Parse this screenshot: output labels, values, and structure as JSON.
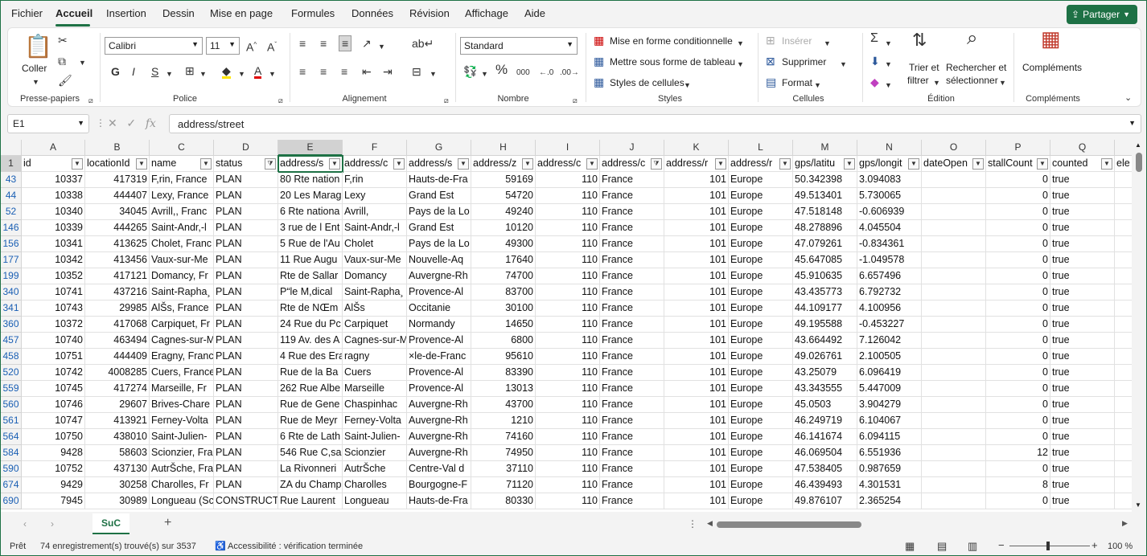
{
  "menu": {
    "tabs": [
      "Fichier",
      "Accueil",
      "Insertion",
      "Dessin",
      "Mise en page",
      "Formules",
      "Données",
      "Révision",
      "Affichage",
      "Aide"
    ],
    "share": "Partager"
  },
  "ribbon": {
    "clipboard": {
      "paste": "Coller",
      "label": "Presse-papiers"
    },
    "font": {
      "name": "Calibri",
      "size": "11",
      "label": "Police"
    },
    "alignment": {
      "label": "Alignement"
    },
    "number": {
      "format": "Standard",
      "label": "Nombre"
    },
    "styles": {
      "conditional": "Mise en forme conditionnelle",
      "table": "Mettre sous forme de tableau",
      "cell_styles": "Styles de cellules",
      "label": "Styles"
    },
    "cells": {
      "insert": "Insérer",
      "delete": "Supprimer",
      "format": "Format",
      "label": "Cellules"
    },
    "editing": {
      "sort1": "Trier et",
      "sort2": "filtrer",
      "find1": "Rechercher et",
      "find2": "sélectionner",
      "label": "Édition"
    },
    "addins": {
      "btn": "Compléments",
      "label": "Compléments"
    }
  },
  "formula_bar": {
    "name_box": "E1",
    "formula": "address/street"
  },
  "columns": [
    "A",
    "B",
    "C",
    "D",
    "E",
    "F",
    "G",
    "H",
    "I",
    "J",
    "K",
    "L",
    "M",
    "N",
    "O",
    "P",
    "Q"
  ],
  "headers": [
    "id",
    "locationId",
    "name",
    "status",
    "address/s",
    "address/c",
    "address/s",
    "address/z",
    "address/c",
    "address/c",
    "address/r",
    "address/r",
    "gps/latitu",
    "gps/longit",
    "dateOpen",
    "stallCount",
    "counted",
    "ele"
  ],
  "rows": [
    [
      "43",
      "10337",
      "417319",
      "F,rin, France",
      "PLAN",
      "80 Rte nation",
      "F,rin",
      "Hauts-de-Fra",
      "59169",
      "110",
      "France",
      "101",
      "Europe",
      "50.342398",
      "3.094083",
      "",
      "0",
      "true"
    ],
    [
      "44",
      "10338",
      "444407",
      "Lexy, France",
      "PLAN",
      "20 Les Marag",
      "Lexy",
      "Grand Est",
      "54720",
      "110",
      "France",
      "101",
      "Europe",
      "49.513401",
      "5.730065",
      "",
      "0",
      "true"
    ],
    [
      "52",
      "10340",
      "34045",
      "Avrill,, Franc",
      "PLAN",
      "6 Rte nationa",
      "Avrill,",
      "Pays de la Lo",
      "49240",
      "110",
      "France",
      "101",
      "Europe",
      "47.518148",
      "-0.606939",
      "",
      "0",
      "true"
    ],
    [
      "146",
      "10339",
      "444265",
      "Saint-Andr,-l",
      "PLAN",
      "3 rue de l Ent",
      "Saint-Andr,-l",
      "Grand Est",
      "10120",
      "110",
      "France",
      "101",
      "Europe",
      "48.278896",
      "4.045504",
      "",
      "0",
      "true"
    ],
    [
      "156",
      "10341",
      "413625",
      "Cholet, Franc",
      "PLAN",
      "5 Rue de l'Au",
      "Cholet",
      "Pays de la Lo",
      "49300",
      "110",
      "France",
      "101",
      "Europe",
      "47.079261",
      "-0.834361",
      "",
      "0",
      "true"
    ],
    [
      "177",
      "10342",
      "413456",
      "Vaux-sur-Me",
      "PLAN",
      "11 Rue Augu",
      "Vaux-sur-Me",
      "Nouvelle-Aq",
      "17640",
      "110",
      "France",
      "101",
      "Europe",
      "45.647085",
      "-1.049578",
      "",
      "0",
      "true"
    ],
    [
      "199",
      "10352",
      "417121",
      "Domancy, Fr",
      "PLAN",
      "Rte de Sallar",
      "Domancy",
      "Auvergne-Rh",
      "74700",
      "110",
      "France",
      "101",
      "Europe",
      "45.910635",
      "6.657496",
      "",
      "0",
      "true"
    ],
    [
      "340",
      "10741",
      "437216",
      "Saint-Rapha¸",
      "PLAN",
      "P“le M,dical",
      "Saint-Rapha¸",
      "Provence-Al",
      "83700",
      "110",
      "France",
      "101",
      "Europe",
      "43.435773",
      "6.792732",
      "",
      "0",
      "true"
    ],
    [
      "341",
      "10743",
      "29985",
      "AlŠs, France",
      "PLAN",
      "Rte de NŒm",
      "AlŠs",
      "Occitanie",
      "30100",
      "110",
      "France",
      "101",
      "Europe",
      "44.109177",
      "4.100956",
      "",
      "0",
      "true"
    ],
    [
      "360",
      "10372",
      "417068",
      "Carpiquet, Fr",
      "PLAN",
      "24 Rue du Pc",
      "Carpiquet",
      "Normandy",
      "14650",
      "110",
      "France",
      "101",
      "Europe",
      "49.195588",
      "-0.453227",
      "",
      "0",
      "true"
    ],
    [
      "457",
      "10740",
      "463494",
      "Cagnes-sur-M",
      "PLAN",
      "119 Av. des A",
      "Cagnes-sur-M",
      "Provence-Al",
      "6800",
      "110",
      "France",
      "101",
      "Europe",
      "43.664492",
      "7.126042",
      "",
      "0",
      "true"
    ],
    [
      "458",
      "10751",
      "444409",
      "Eragny, Franc",
      "PLAN",
      "4 Rue des Era",
      "ragny",
      "×le-de-Franc",
      "95610",
      "110",
      "France",
      "101",
      "Europe",
      "49.026761",
      "2.100505",
      "",
      "0",
      "true"
    ],
    [
      "520",
      "10742",
      "4008285",
      "Cuers, France",
      "PLAN",
      "Rue de la Ba",
      "Cuers",
      "Provence-Al",
      "83390",
      "110",
      "France",
      "101",
      "Europe",
      "43.25079",
      "6.096419",
      "",
      "0",
      "true"
    ],
    [
      "559",
      "10745",
      "417274",
      "Marseille, Fr",
      "PLAN",
      "262 Rue Albe",
      "Marseille",
      "Provence-Al",
      "13013",
      "110",
      "France",
      "101",
      "Europe",
      "43.343555",
      "5.447009",
      "",
      "0",
      "true"
    ],
    [
      "560",
      "10746",
      "29607",
      "Brives-Chare",
      "PLAN",
      "Rue de Gene",
      "Chaspinhac",
      "Auvergne-Rh",
      "43700",
      "110",
      "France",
      "101",
      "Europe",
      "45.0503",
      "3.904279",
      "",
      "0",
      "true"
    ],
    [
      "561",
      "10747",
      "413921",
      "Ferney-Volta",
      "PLAN",
      "Rue de Meyr",
      "Ferney-Volta",
      "Auvergne-Rh",
      "1210",
      "110",
      "France",
      "101",
      "Europe",
      "46.249719",
      "6.104067",
      "",
      "0",
      "true"
    ],
    [
      "564",
      "10750",
      "438010",
      "Saint-Julien-",
      "PLAN",
      "6 Rte de Lath",
      "Saint-Julien-",
      "Auvergne-Rh",
      "74160",
      "110",
      "France",
      "101",
      "Europe",
      "46.141674",
      "6.094115",
      "",
      "0",
      "true"
    ],
    [
      "584",
      "9428",
      "58603",
      "Scionzier, Fra",
      "PLAN",
      "546 Rue C,sa",
      "Scionzier",
      "Auvergne-Rh",
      "74950",
      "110",
      "France",
      "101",
      "Europe",
      "46.069504",
      "6.551936",
      "",
      "12",
      "true"
    ],
    [
      "590",
      "10752",
      "437130",
      "AutrŠche, Fra",
      "PLAN",
      "La Rivonneri",
      "AutrŠche",
      "Centre-Val d",
      "37110",
      "110",
      "France",
      "101",
      "Europe",
      "47.538405",
      "0.987659",
      "",
      "0",
      "true"
    ],
    [
      "674",
      "9429",
      "30258",
      "Charolles, Fr",
      "PLAN",
      "ZA du Champ",
      "Charolles",
      "Bourgogne-F",
      "71120",
      "110",
      "France",
      "101",
      "Europe",
      "46.439493",
      "4.301531",
      "",
      "8",
      "true"
    ],
    [
      "690",
      "7945",
      "30989",
      "Longueau (Sc",
      "CONSTRUCTI",
      "Rue Laurent",
      "Longueau",
      "Hauts-de-Fra",
      "80330",
      "110",
      "France",
      "101",
      "Europe",
      "49.876107",
      "2.365254",
      "",
      "0",
      "true"
    ]
  ],
  "sheet": {
    "tab": "SuC"
  },
  "status": {
    "ready": "Prêt",
    "records": "74 enregistrement(s) trouvé(s) sur 3537",
    "accessibility": "Accessibilité : vérification terminée",
    "zoom": "100 %"
  }
}
